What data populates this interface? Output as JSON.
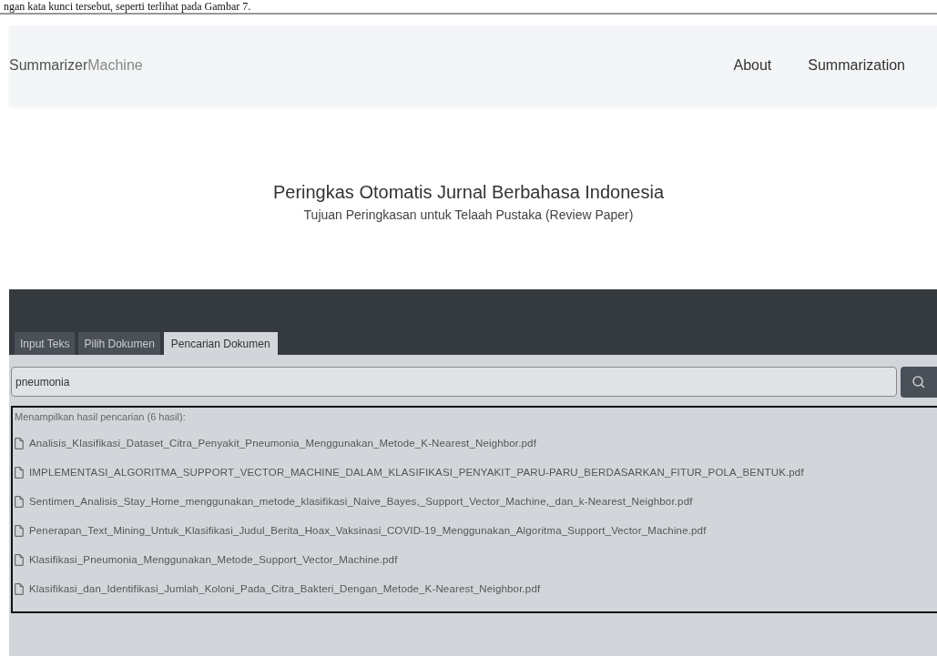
{
  "document_text": "ngan kata kunci tersebut, seperti terlihat pada Gambar 7.",
  "navbar": {
    "brand_bold": "Summarizer",
    "brand_light": "Machine",
    "links": [
      "About",
      "Summarization"
    ]
  },
  "header": {
    "title": "Peringkas Otomatis Jurnal Berbahasa Indonesia",
    "subtitle": "Tujuan Peringkasan untuk Telaah Pustaka (Review Paper)"
  },
  "tabs": [
    {
      "label": "Input Teks",
      "selected": false
    },
    {
      "label": "Pilih Dokumen",
      "selected": false
    },
    {
      "label": "Pencarian Dokumen",
      "selected": true
    }
  ],
  "search": {
    "value": "pneumonia"
  },
  "results": {
    "summary": "Menampilkan hasil pencarian (6 hasil):",
    "files": [
      "Analisis_Klasifikasi_Dataset_Citra_Penyakit_Pneumonia_Menggunakan_Metode_K-Nearest_Neighbor.pdf",
      "IMPLEMENTASI_ALGORITMA_SUPPORT_VECTOR_MACHINE_DALAM_KLASIFIKASI_PENYAKIT_PARU-PARU_BERDASARKAN_FITUR_POLA_BENTUK.pdf",
      "Sentimen_Analisis_Stay_Home_menggunakan_metode_klasifikasi_Naive_Bayes,_Support_Vector_Machine,_dan_k-Nearest_Neighbor.pdf",
      "Penerapan_Text_Mining_Untuk_Klasifikasi_Judul_Berita_Hoax_Vaksinasi_COVID-19_Menggunakan_Algoritma_Support_Vector_Machine.pdf",
      "Klasifikasi_Pneumonia_Menggunakan_Metode_Support_Vector_Machine.pdf",
      "Klasifikasi_dan_Identifikasi_Jumlah_Koloni_Pada_Citra_Bakteri_Dengan_Metode_K-Nearest_Neighbor.pdf"
    ]
  }
}
